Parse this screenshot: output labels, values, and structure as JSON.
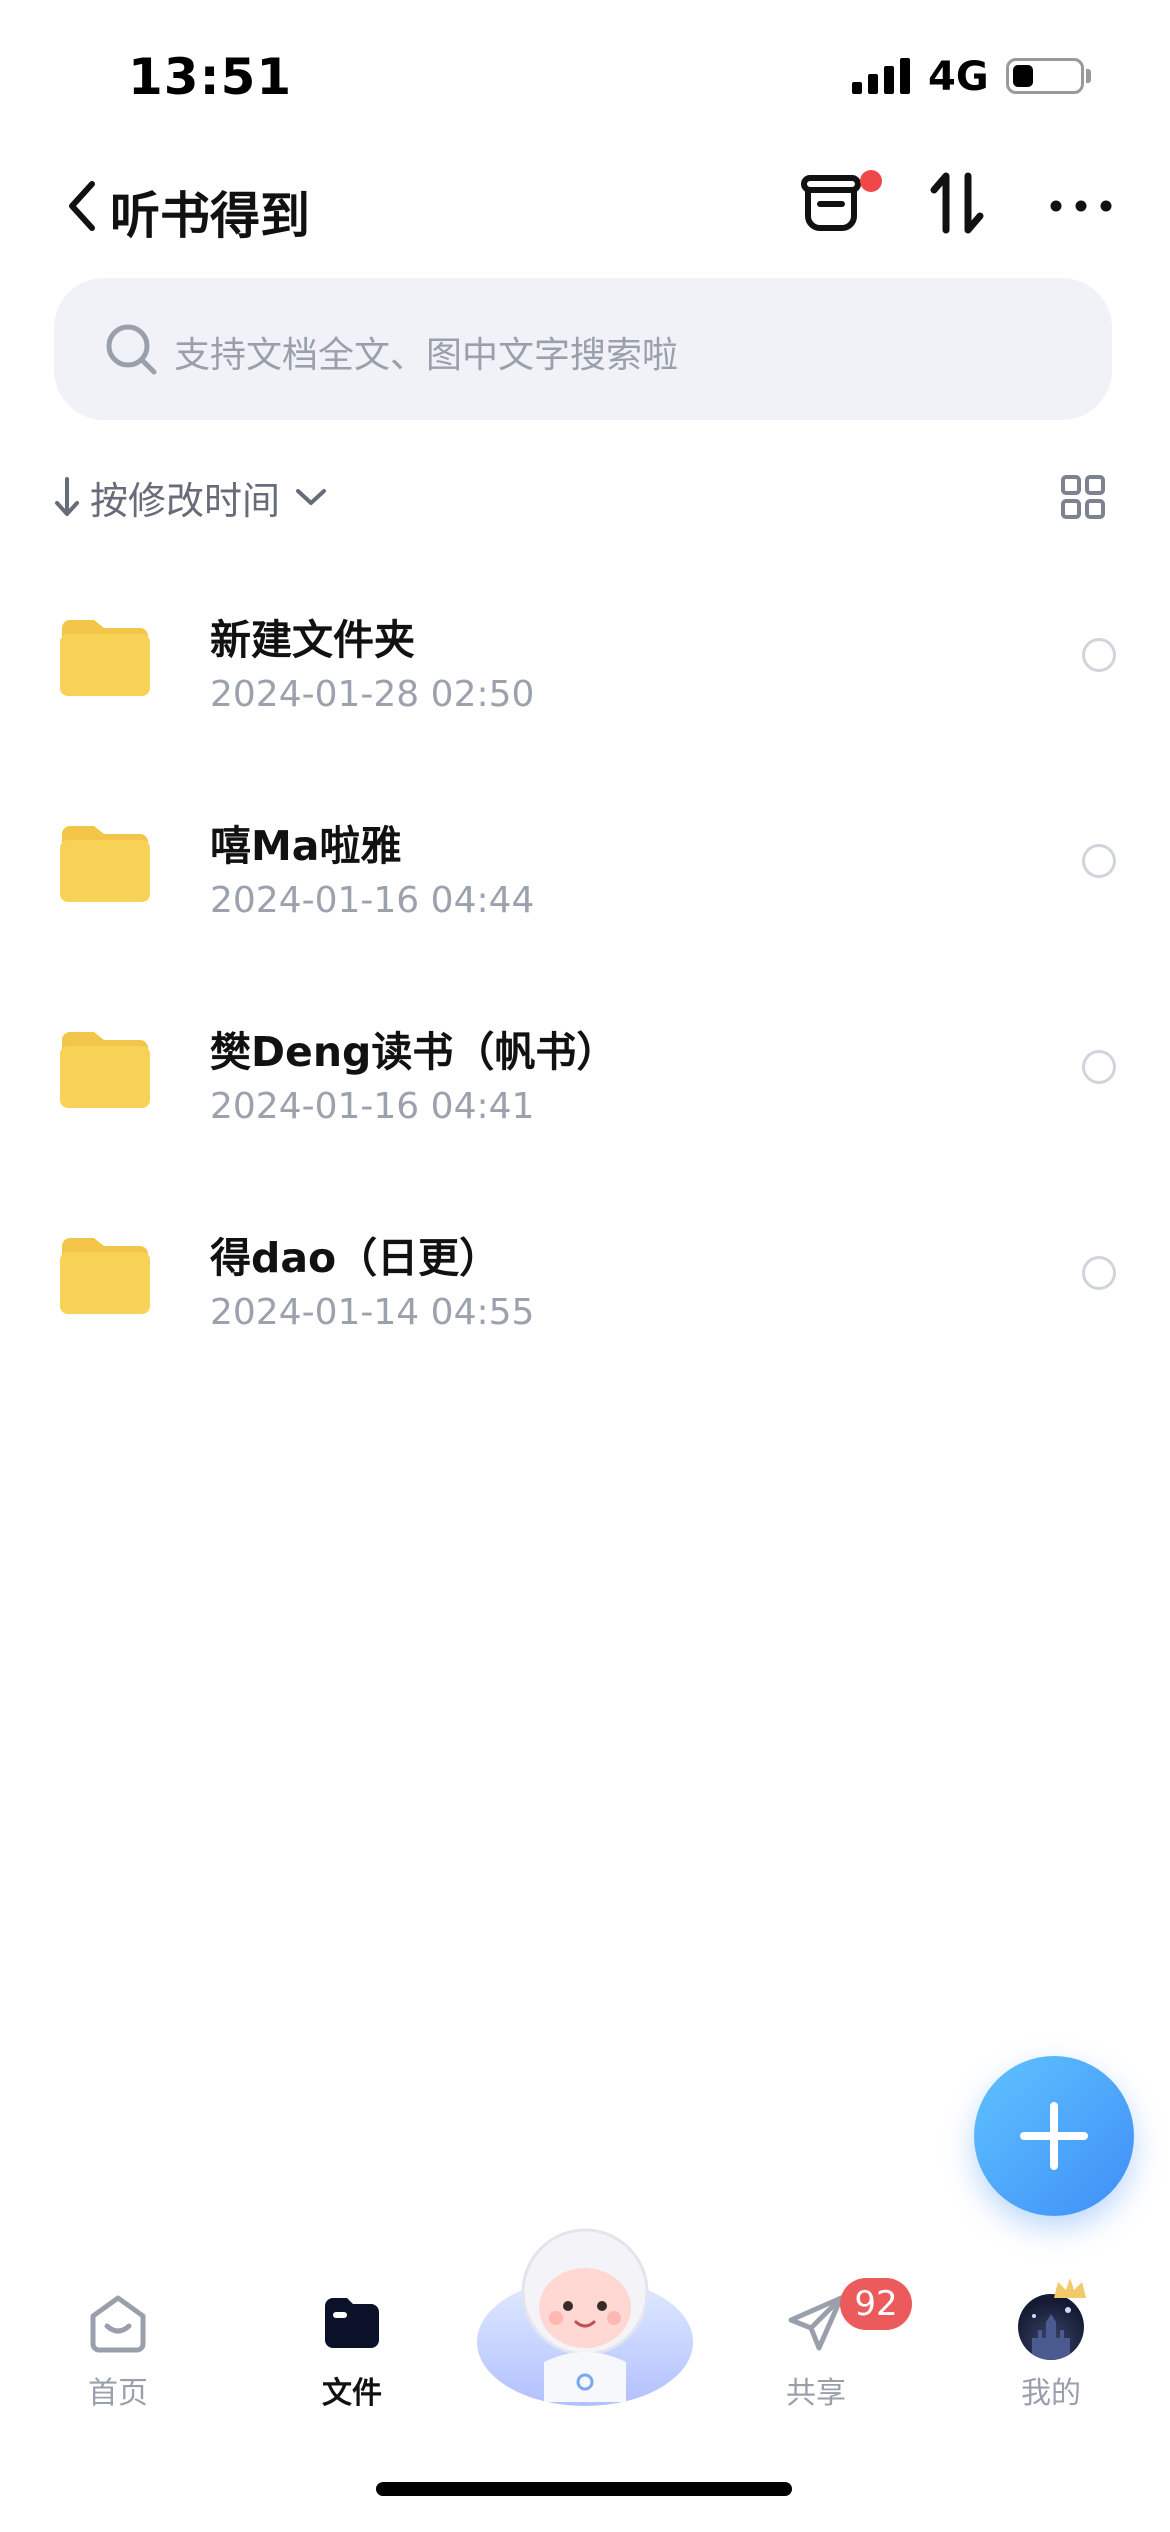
{
  "status_bar": {
    "time": "13:51",
    "network": "4G"
  },
  "nav": {
    "title": "听书得到",
    "icons": [
      "back-chevron-icon",
      "transfer-box-icon",
      "sort-swap-icon",
      "more-dots-icon"
    ],
    "has_notification_dot": true
  },
  "search": {
    "placeholder": "支持文档全文、图中文字搜索啦"
  },
  "sort": {
    "label": "按修改时间",
    "direction": "descending"
  },
  "files": [
    {
      "name": "新建文件夹",
      "date": "2024-01-28 02:50",
      "type": "folder"
    },
    {
      "name": "嘻Ma啦雅",
      "date": "2024-01-16 04:44",
      "type": "folder"
    },
    {
      "name": "樊Deng读书（帆书）",
      "date": "2024-01-16 04:41",
      "type": "folder"
    },
    {
      "name": "得dao（日更）",
      "date": "2024-01-14 04:55",
      "type": "folder"
    }
  ],
  "tabbar": {
    "home": "首页",
    "files": "文件",
    "share": "共享",
    "share_badge": "92",
    "mine": "我的",
    "active": "files"
  },
  "colors": {
    "accent_blue": "#3f8ef7",
    "folder_yellow": "#f8d257",
    "badge_red": "#ec5b5b",
    "notification_red": "#f04848"
  }
}
